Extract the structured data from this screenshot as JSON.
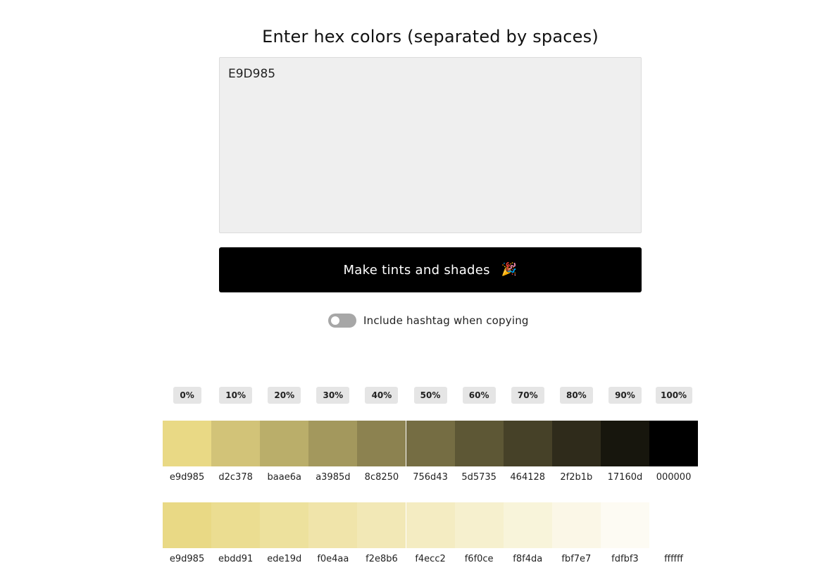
{
  "title": "Enter hex colors (separated by spaces)",
  "input": {
    "value": "E9D985"
  },
  "button": {
    "label": "Make tints and shades",
    "icon": "party-popper-icon",
    "emoji": "🎉"
  },
  "toggle": {
    "label": "Include hashtag when copying",
    "on": false
  },
  "percentages": [
    "0%",
    "10%",
    "20%",
    "30%",
    "40%",
    "50%",
    "60%",
    "70%",
    "80%",
    "90%",
    "100%"
  ],
  "shades": [
    "e9d985",
    "d2c378",
    "baae6a",
    "a3985d",
    "8c8250",
    "756d43",
    "5d5735",
    "464128",
    "2f2b1b",
    "17160d",
    "000000"
  ],
  "tints": [
    "e9d985",
    "ebdd91",
    "ede19d",
    "f0e4aa",
    "f2e8b6",
    "f4ecc2",
    "f6f0ce",
    "f8f4da",
    "fbf7e7",
    "fdfbf3",
    "ffffff"
  ]
}
